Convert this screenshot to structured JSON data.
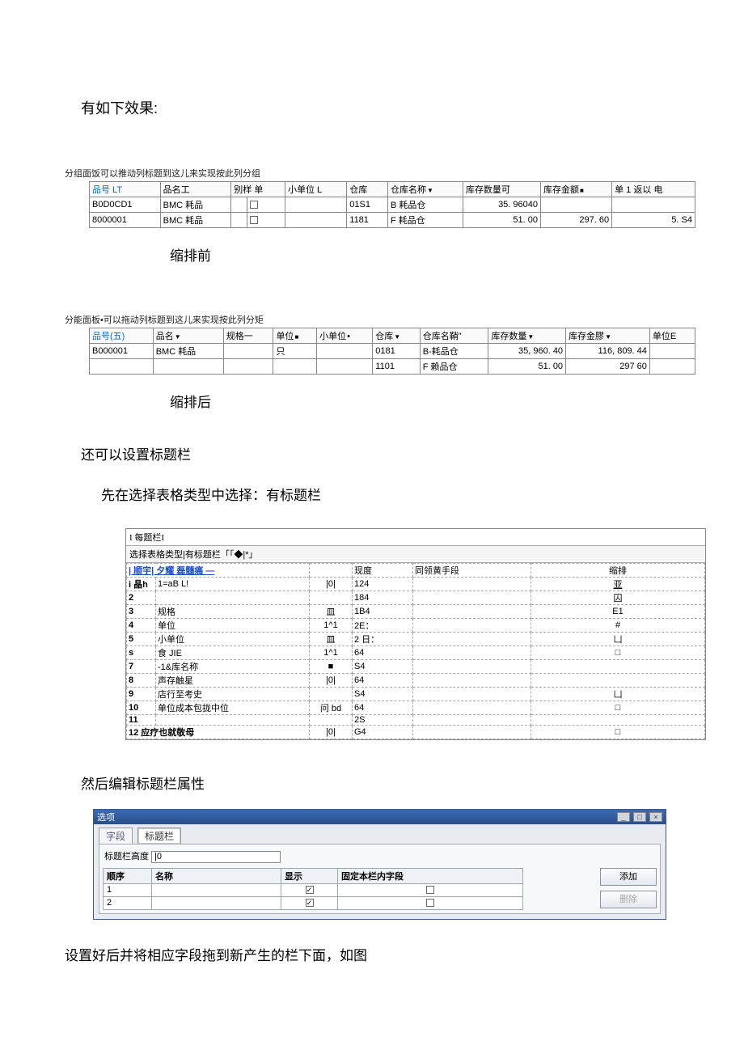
{
  "intro": {
    "title": "有如下效果:"
  },
  "grid1": {
    "hint": "分组面饭可以推动列标题到这儿来实现按此列分组",
    "headers": [
      "品号 LT",
      "品名工",
      "别样 单",
      "小单位 L",
      "仓库",
      "仓库名称",
      "库存数量可",
      "库存金额",
      "单 1 返以  电"
    ],
    "rows": [
      {
        "code": "B0D0CD1",
        "name": "BMC 耗品",
        "spec": "",
        "chk": true,
        "sunit": "",
        "wh": "01S1",
        "whname": "B 耗品仓",
        "qty": "35. 96040",
        "amt": "",
        "unit": ""
      },
      {
        "code": "8000001",
        "name": "BMC 耗品",
        "spec": "",
        "chk": true,
        "sunit": "",
        "wh": "1181",
        "whname": "F 耗品仓",
        "qty": "51. 00",
        "amt": "297. 60",
        "unit": "5. S4"
      }
    ],
    "caption": "缩排前"
  },
  "grid2": {
    "hint": "分能面板•可以拖动列标题到这儿来实现按此列分矩",
    "headers": [
      "品号(五)",
      "品名",
      "规格一",
      "单位",
      "小单位",
      "仓库",
      "仓库名鞘\"",
      "库存数量",
      "库存金膠",
      "单位E"
    ],
    "rows": [
      {
        "code": "B000001",
        "name": "BMC 耗品",
        "spec": "",
        "unit": "只",
        "sunit": "",
        "wh": "0181",
        "whname": "B-耗品仓",
        "qty": "35, 960. 40",
        "amt": "116, 809. 44",
        "ucol": ""
      },
      {
        "code": "",
        "name": "",
        "spec": "",
        "unit": "",
        "sunit": "",
        "wh": "1101",
        "whname": "F 赖品仓",
        "qty": "51. 00",
        "amt": "297 60",
        "ucol": ""
      }
    ],
    "caption": "缩排后"
  },
  "section": {
    "text1": "还可以设置标题栏",
    "text2": "先在选择表格类型中选择：有标题栏"
  },
  "config": {
    "tab": "I 每题栏I",
    "typeRow": "选择表格类型|有标题栏「「◆|*｣",
    "headers": {
      "seq": "| 顺宇| 夕耀 磊髓痛 —",
      "align": "",
      "width": "现度",
      "field": "同领黄手段",
      "shrink": "缩排"
    },
    "rows": [
      {
        "seq": "i 晶h",
        "name": "1=aB L!",
        "align": "|0|",
        "width": "124",
        "field": "",
        "shrink": "亚"
      },
      {
        "seq": "2",
        "name": "",
        "align": "",
        "width": "184",
        "field": "",
        "shrink": "囚"
      },
      {
        "seq": "3",
        "name": "规格",
        "align": "皿",
        "width": "1B4",
        "field": "",
        "shrink": "E1"
      },
      {
        "seq": "4",
        "name": "单位",
        "align": "1^1",
        "width": "2E：",
        "field": "",
        "shrink": "#"
      },
      {
        "seq": "5",
        "name": "小单位",
        "align": "皿",
        "width": "2 日：",
        "field": "",
        "shrink": "凵"
      },
      {
        "seq": "s",
        "name": "食 JIE",
        "align": "1^1",
        "width": "64",
        "field": "",
        "shrink": "□"
      },
      {
        "seq": "7",
        "name": "-1&库名称",
        "align": "■",
        "width": "S4",
        "field": "",
        "shrink": ""
      },
      {
        "seq": "8",
        "name": "声存触星",
        "align": "|0|",
        "width": "64",
        "field": "",
        "shrink": ""
      },
      {
        "seq": "9",
        "name": "店行至考史",
        "align": "",
        "width": "S4",
        "field": "",
        "shrink": "凵"
      },
      {
        "seq": "10",
        "name": "单位成本包拢中位",
        "align": "问 bd",
        "width": "64",
        "field": "",
        "shrink": "□"
      },
      {
        "seq": "11",
        "name": "",
        "align": "",
        "width": "2S",
        "field": "",
        "shrink": ""
      }
    ],
    "footer": {
      "seq": "12 应疗也就敬母",
      "align": "|0|",
      "width": "G4",
      "shrink": "□"
    }
  },
  "section2": {
    "text": "然后编辑标题栏属性"
  },
  "dialog": {
    "title": "选项",
    "tabs": {
      "fields": "字段",
      "titlebar": "标题栏"
    },
    "heightLabel": "标题栏高度",
    "heightValue": "|0",
    "headers": {
      "seq": "顺序",
      "name": "名称",
      "show": "显示",
      "lock": "固定本栏内字段"
    },
    "rows": [
      {
        "seq": "1",
        "name": "",
        "show": true,
        "lock": false
      },
      {
        "seq": "2",
        "name": "",
        "show": true,
        "lock": false
      }
    ],
    "buttons": {
      "add": "添加",
      "del": "删除"
    }
  },
  "footer": {
    "text": "设置好后并将相应字段拖到新产生的栏下面，如图"
  }
}
